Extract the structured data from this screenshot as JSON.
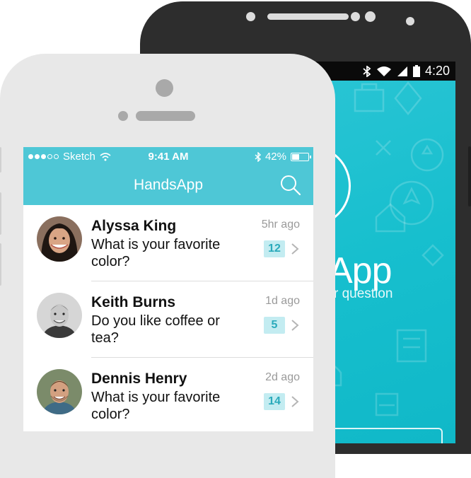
{
  "android": {
    "status_time": "4:20",
    "app_name_partial": "App",
    "tagline_partial": "r question",
    "screen_color": "#17bfce"
  },
  "iphone": {
    "status": {
      "carrier": "Sketch",
      "time": "9:41 AM",
      "battery": "42%",
      "battery_level": 0.42
    },
    "nav_title": "HandsApp",
    "accent_color": "#4ec7d6",
    "conversations": [
      {
        "name": "Alyssa King",
        "message": "What is your favorite color?",
        "time_ago": "5hr ago",
        "count": "12"
      },
      {
        "name": "Keith Burns",
        "message": "Do you like coffee or tea?",
        "time_ago": "1d ago",
        "count": "5"
      },
      {
        "name": "Dennis Henry",
        "message": "What is your favorite color?",
        "time_ago": "2d ago",
        "count": "14"
      }
    ]
  }
}
